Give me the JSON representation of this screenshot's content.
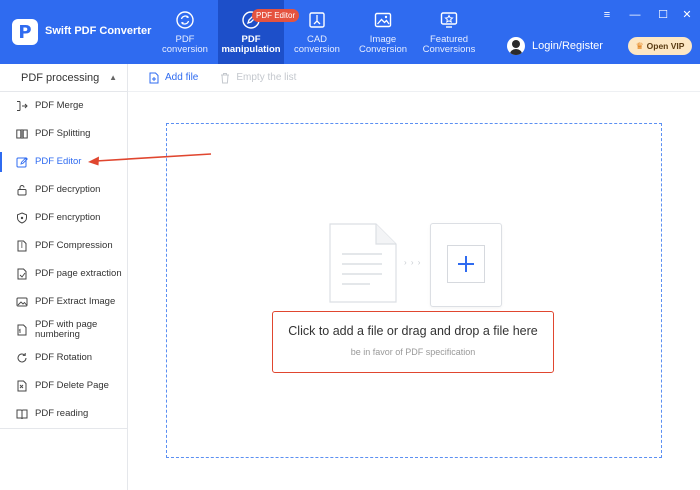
{
  "app": {
    "title": "Swift PDF Converter",
    "logo_letter": "P"
  },
  "nav": {
    "items": [
      {
        "label": "PDF\nconversion",
        "icon": "refresh-doc-icon"
      },
      {
        "label": "PDF\nmanipulation",
        "icon": "pdf-edit-icon",
        "active": true
      },
      {
        "label": "CAD\nconversion",
        "icon": "cad-icon"
      },
      {
        "label": "Image\nConversion",
        "icon": "image-icon"
      },
      {
        "label": "Featured\nConversions",
        "icon": "star-screen-icon"
      }
    ],
    "badge": "PDF Editor"
  },
  "header": {
    "login_label": "Login/Register",
    "vip_label": "Open VIP",
    "window_controls": [
      "≡",
      "—",
      "☐",
      "✕"
    ]
  },
  "sidebar": {
    "section_title": "PDF processing",
    "items": [
      {
        "label": "PDF Merge",
        "icon": "merge-icon"
      },
      {
        "label": "PDF Splitting",
        "icon": "split-icon"
      },
      {
        "label": "PDF Editor",
        "icon": "edit-icon",
        "active": true
      },
      {
        "label": "PDF decryption",
        "icon": "unlock-icon"
      },
      {
        "label": "PDF encryption",
        "icon": "shield-icon"
      },
      {
        "label": "PDF Compression",
        "icon": "compress-icon"
      },
      {
        "label": "PDF page extraction",
        "icon": "extract-icon"
      },
      {
        "label": "PDF Extract Image",
        "icon": "image-icon"
      },
      {
        "label": "PDF with page numbering",
        "icon": "numbering-icon"
      },
      {
        "label": "PDF Rotation",
        "icon": "rotate-icon"
      },
      {
        "label": "PDF Delete Page",
        "icon": "delete-page-icon"
      },
      {
        "label": "PDF reading",
        "icon": "book-icon"
      }
    ]
  },
  "toolbar": {
    "add_file": "Add file",
    "empty_list": "Empty the list"
  },
  "dropzone": {
    "main_text": "Click to add a file or drag and drop a file here",
    "sub_text": "be in favor of PDF specification",
    "dots": "› › ›"
  },
  "colors": {
    "primary": "#2f6bf0",
    "highlight": "#e0462f",
    "badge": "#e5533f"
  }
}
